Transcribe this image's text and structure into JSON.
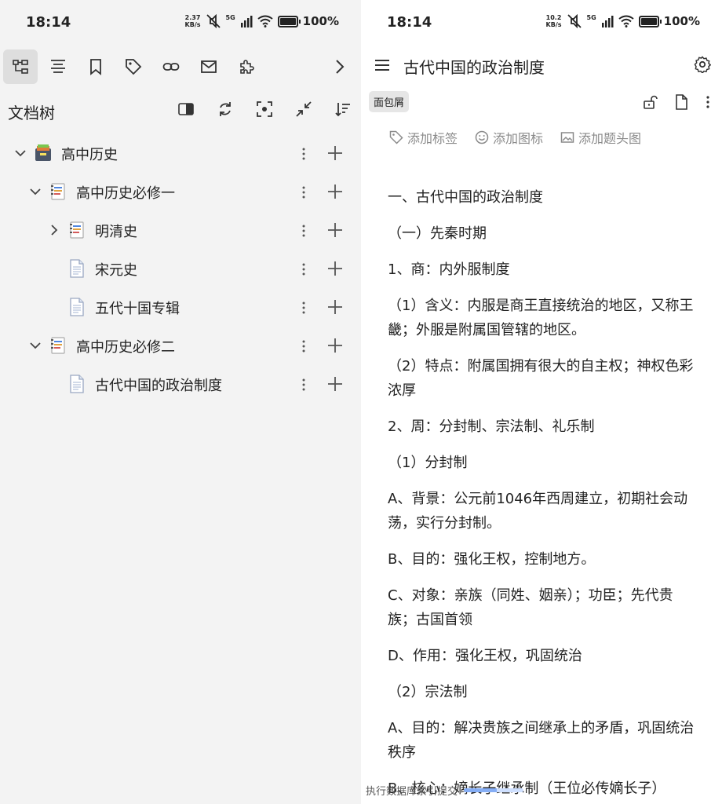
{
  "status_left": {
    "time": "18:14",
    "speed_value": "2.37",
    "speed_unit": "KB/s",
    "network": "5G",
    "battery": "100%"
  },
  "status_right": {
    "time": "18:14",
    "speed_value": "10.2",
    "speed_unit": "KB/s",
    "network": "5G",
    "battery": "100%"
  },
  "toolbar": {
    "icons": [
      "doc-tree-icon",
      "outline-icon",
      "bookmark-icon",
      "tag-icon",
      "link-icon",
      "mail-icon",
      "plugin-icon",
      "chevron-right-icon"
    ]
  },
  "tree_header": {
    "title": "文档树"
  },
  "tree": {
    "items": [
      {
        "label": "高中历史",
        "level": 0,
        "expanded": true,
        "icon": "notebook-icon"
      },
      {
        "label": "高中历史必修一",
        "level": 1,
        "expanded": true,
        "icon": "multi-doc-icon"
      },
      {
        "label": "明清史",
        "level": 2,
        "expanded": false,
        "icon": "multi-doc-icon"
      },
      {
        "label": "宋元史",
        "level": 2,
        "icon": "doc-icon"
      },
      {
        "label": "五代十国专辑",
        "level": 2,
        "icon": "doc-icon"
      },
      {
        "label": "高中历史必修二",
        "level": 1,
        "expanded": true,
        "icon": "multi-doc-icon"
      },
      {
        "label": "古代中国的政治制度",
        "level": 2,
        "icon": "doc-icon"
      }
    ]
  },
  "editor": {
    "title": "古代中国的政治制度",
    "breadcrumb": "面包屑",
    "meta": {
      "add_tag": "添加标签",
      "add_icon": "添加图标",
      "add_cover": "添加题头图"
    },
    "paragraphs": [
      "一、古代中国的政治制度",
      "（一）先秦时期",
      "1、商：内外服制度",
      "（1）含义：内服是商王直接统治的地区，又称王畿；外服是附属国管辖的地区。",
      "（2）特点：附属国拥有很大的自主权；神权色彩浓厚",
      "2、周：分封制、宗法制、礼乐制",
      "（1）分封制",
      "A、背景：公元前1046年西周建立，初期社会动荡，实行分封制。",
      "B、目的：强化王权，控制地方。",
      "C、对象：亲族（同姓、姻亲）；功臣；先代贵族；古国首领",
      "D、作用：强化王权，巩固统治",
      "（2）宗法制",
      "A、目的：解决贵族之间继承上的矛盾，巩固统治秩序",
      "B、核心：嫡长子继承制（王位必传嫡长子）"
    ]
  },
  "bottom_status": {
    "text": "执行数据库索引提交",
    "progress": 0.55
  },
  "colors": {
    "left_bg": "#f3f3f3",
    "active_tab": "#dedede",
    "meta_gray": "#8a8a8a",
    "progress": "#86aef5"
  }
}
